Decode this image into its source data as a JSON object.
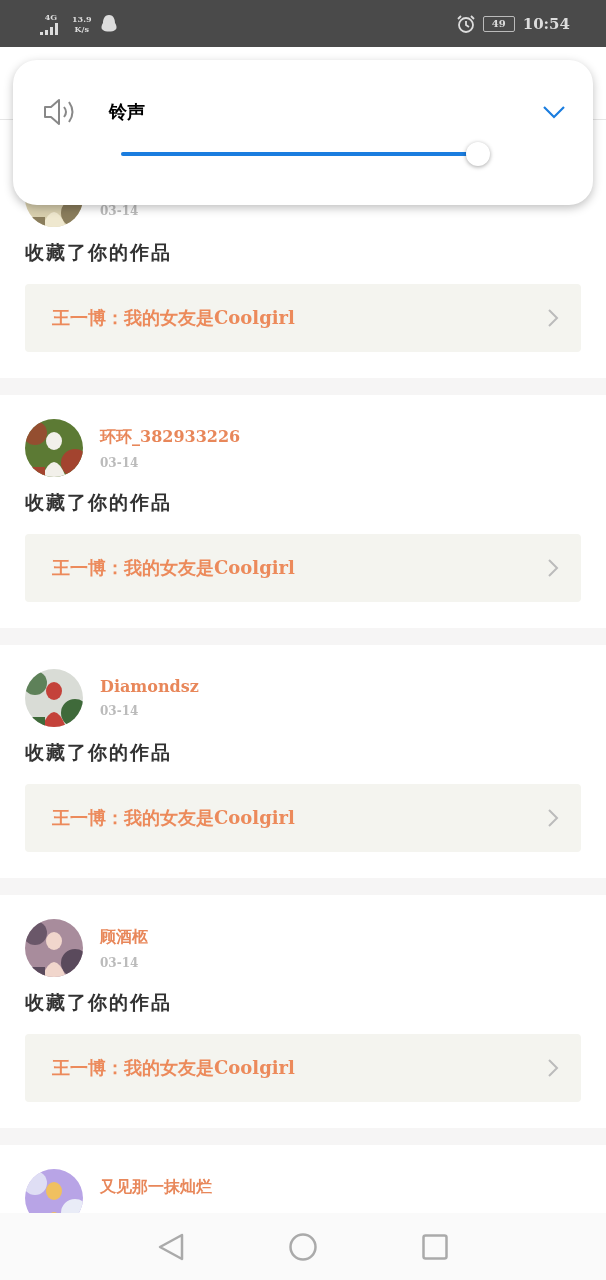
{
  "status_bar": {
    "network": "4G",
    "speed": "13.9",
    "speed_unit": "K/s",
    "battery": "49",
    "time": "10:54"
  },
  "volume_popup": {
    "label": "铃声",
    "level": 1
  },
  "notifications": [
    {
      "date": "03-14",
      "action": "收藏了你的作品",
      "work": "王一博：我的女友是Coolgirl"
    },
    {
      "user": "环环_382933226",
      "date": "03-14",
      "action": "收藏了你的作品",
      "work": "王一博：我的女友是Coolgirl"
    },
    {
      "user": "Diamondsz",
      "date": "03-14",
      "action": "收藏了你的作品",
      "work": "王一博：我的女友是Coolgirl"
    },
    {
      "user": "顾酒柩",
      "date": "03-14",
      "action": "收藏了你的作品",
      "work": "王一博：我的女友是Coolgirl"
    },
    {
      "user": "又见那一抹灿烂"
    }
  ]
}
